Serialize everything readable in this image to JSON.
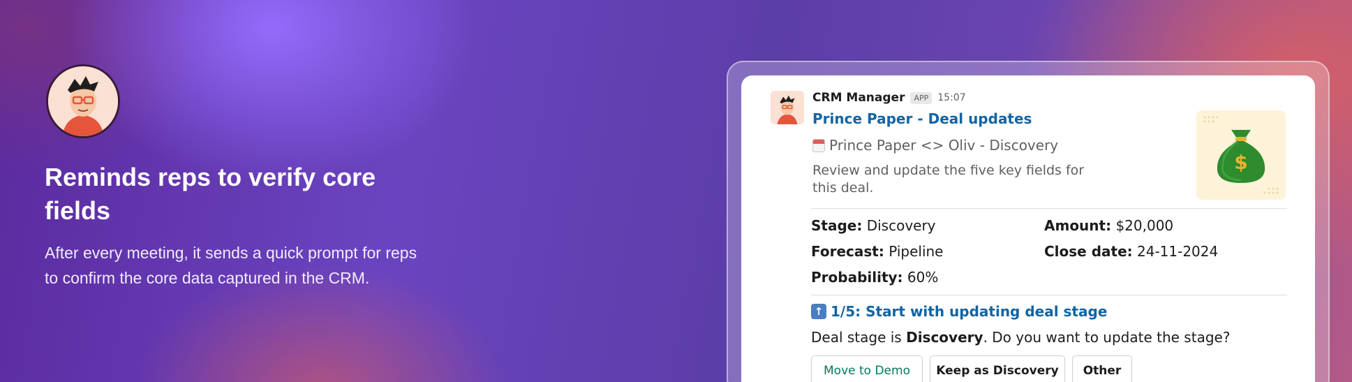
{
  "hero": {
    "title": "Reminds reps to verify core fields",
    "description": "After every meeting, it sends a quick prompt for reps to confirm the core data captured in the CRM."
  },
  "message": {
    "sender": "CRM Manager",
    "badge": "APP",
    "time": "15:07",
    "deal_link": "Prince Paper - Deal updates",
    "meeting_icon": "calendar-icon",
    "meeting": "Prince Paper <> Oliv - Discovery",
    "review_text": "Review and update the five key fields for this deal.",
    "image_icon": "money-bag-icon"
  },
  "fields": [
    {
      "label": "Stage:",
      "value": "Discovery"
    },
    {
      "label": "Amount:",
      "value": "$20,000"
    },
    {
      "label": "Forecast:",
      "value": "Pipeline"
    },
    {
      "label": "Close date:",
      "value": "24-11-2024"
    },
    {
      "label": "Probability:",
      "value": "60%"
    }
  ],
  "step": {
    "icon": "up-arrow-icon",
    "label": "1/5: Start with updating deal stage"
  },
  "question": {
    "prefix": "Deal stage is ",
    "stage": "Discovery",
    "suffix": ". Do you want to update the stage?"
  },
  "buttons": [
    {
      "label": "Move to Demo"
    },
    {
      "label": "Keep as Discovery"
    },
    {
      "label": "Other"
    }
  ],
  "colors": {
    "link": "#1264a3",
    "primary_button_text": "#007a5a",
    "money_bag": "#2e8b2e"
  }
}
